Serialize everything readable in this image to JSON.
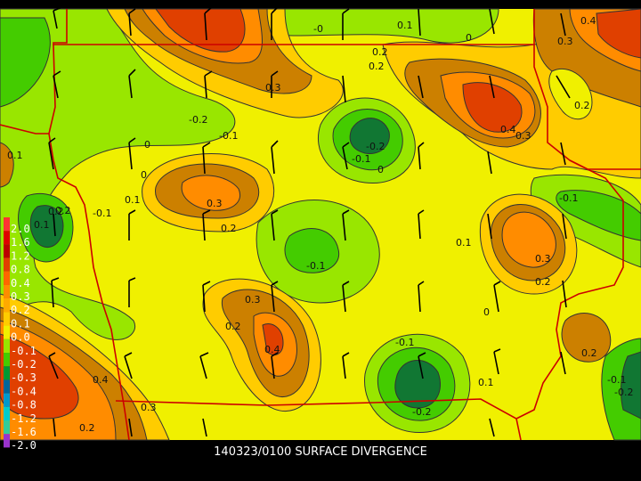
{
  "caption": "140323/0100 SURFACE DIVERGENCE",
  "background_color": "#000000",
  "colors": {
    "pos_0.0": "#99e600",
    "pos_0.1": "#f0f000",
    "pos_0.2": "#ffcc00",
    "pos_0.3": "#cc8000",
    "pos_0.4": "#ff8c00",
    "pos_0.8": "#e04000",
    "neg_-0.1": "#66dd00",
    "neg_-0.2": "#22aa22",
    "neg_-0.3": "#117733",
    "boundary": "#cc0000",
    "contour": "#333333",
    "barb": "#000000"
  },
  "legend": [
    {
      "label": "2.0",
      "color": "#ff3333"
    },
    {
      "label": "1.6",
      "color": "#dd0000"
    },
    {
      "label": "1.2",
      "color": "#bb0000"
    },
    {
      "label": "0.8",
      "color": "#e04000"
    },
    {
      "label": "0.4",
      "color": "#ff6600"
    },
    {
      "label": "0.3",
      "color": "#ff8c00"
    },
    {
      "label": "0.2",
      "color": "#ffaa00"
    },
    {
      "label": "0.1",
      "color": "#ffcc00"
    },
    {
      "label": "0.0",
      "color": "#f0f000"
    },
    {
      "label": "-0.1",
      "color": "#99e600"
    },
    {
      "label": "-0.2",
      "color": "#44cc00"
    },
    {
      "label": "-0.3",
      "color": "#009933"
    },
    {
      "label": "-0.4",
      "color": "#006699"
    },
    {
      "label": "-0.8",
      "color": "#0099cc"
    },
    {
      "label": "-1.2",
      "color": "#00cccc"
    },
    {
      "label": "-1.6",
      "color": "#33cc99"
    },
    {
      "label": "-2.0",
      "color": "#9933cc"
    }
  ],
  "contour_labels": [
    "-0",
    "0.1",
    "0",
    "0.3",
    "0.4",
    "0.2",
    "0.2",
    "0.3",
    "-0.2",
    "-0.1",
    "0.4",
    "0.3",
    "0.2",
    "-0.2",
    "-0.1",
    "0",
    "0.1",
    "0",
    "0.3",
    "0.1",
    "0.2",
    "-0.1",
    "0.1",
    "-0.1",
    "0.2",
    "-0.1",
    "0.3",
    "0.2",
    "0.3",
    "0.2",
    "0.4",
    "-0.1",
    "0",
    "0.4",
    "0.3",
    "0.2",
    "0.1",
    "-0.2",
    "0.2",
    "-0.1",
    "-0.2",
    "0.1",
    "0.2",
    "0"
  ]
}
